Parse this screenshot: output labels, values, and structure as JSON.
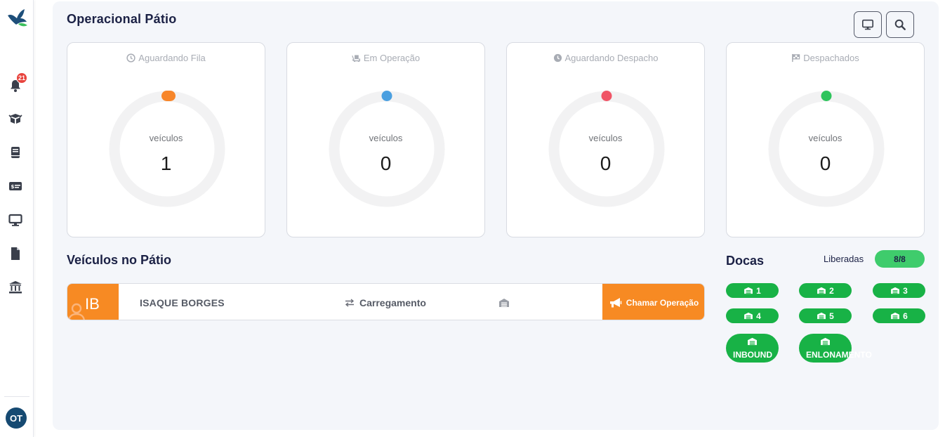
{
  "sidebar": {
    "bell_count": "21",
    "avatar_initials": "OT"
  },
  "header": {
    "title": "Operacional Pátio"
  },
  "stats": [
    {
      "title": "Aguardando Fila",
      "label": "veículos",
      "value": "1",
      "color": "#f7862a"
    },
    {
      "title": "Em Operação",
      "label": "veículos",
      "value": "0",
      "color": "#4a9fe0"
    },
    {
      "title": "Aguardando Despacho",
      "label": "veículos",
      "value": "0",
      "color": "#f05466"
    },
    {
      "title": "Despachados",
      "label": "veículos",
      "value": "0",
      "color": "#2ec45c"
    }
  ],
  "vehicles": {
    "title": "Veículos no Pátio",
    "items": [
      {
        "initials": "IB",
        "name": "ISAQUE BORGES",
        "operation": "Carregamento",
        "action": "Chamar Operação"
      }
    ]
  },
  "docks": {
    "title": "Docas",
    "released_label": "Liberadas",
    "released_value": "8/8",
    "items": [
      "1",
      "2",
      "3",
      "4",
      "5",
      "6",
      "INBOUND",
      "ENLONAMENTO"
    ]
  },
  "colors": {
    "accent_orange": "#f78a23",
    "dock_green": "#18b246",
    "title_navy": "#1b2145"
  }
}
